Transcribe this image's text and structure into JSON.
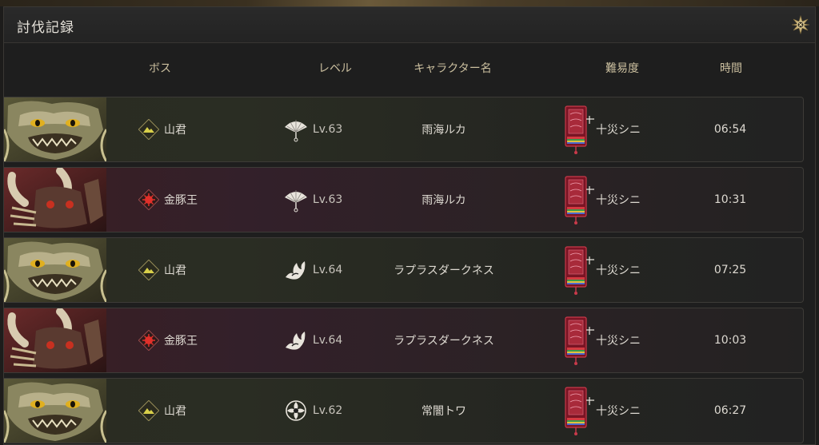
{
  "window": {
    "title": "討伐記録"
  },
  "columns": {
    "boss": "ボス",
    "level": "レベル",
    "character": "キャラクター名",
    "difficulty": "難易度",
    "time": "時間"
  },
  "colors": {
    "header_text": "#cbbf9f",
    "row_border": "#3d3b37",
    "accent_gold": "#c9b27a"
  },
  "records": [
    {
      "boss": "山君",
      "boss_type": "mountain",
      "level": "Lv.63",
      "level_icon": "fan-icon",
      "character": "雨海ルカ",
      "difficulty": "十災シニ",
      "time": "06:54"
    },
    {
      "boss": "金豚王",
      "boss_type": "pig",
      "level": "Lv.63",
      "level_icon": "fan-icon",
      "character": "雨海ルカ",
      "difficulty": "十災シニ",
      "time": "10:31"
    },
    {
      "boss": "山君",
      "boss_type": "mountain",
      "level": "Lv.64",
      "level_icon": "flame-icon",
      "character": "ラプラスダークネス",
      "difficulty": "十災シニ",
      "time": "07:25"
    },
    {
      "boss": "金豚王",
      "boss_type": "pig",
      "level": "Lv.64",
      "level_icon": "flame-icon",
      "character": "ラプラスダークネス",
      "difficulty": "十災シニ",
      "time": "10:03"
    },
    {
      "boss": "山君",
      "boss_type": "mountain",
      "level": "Lv.62",
      "level_icon": "flower-icon",
      "character": "常闇トワ",
      "difficulty": "十災シニ",
      "time": "06:27"
    }
  ]
}
